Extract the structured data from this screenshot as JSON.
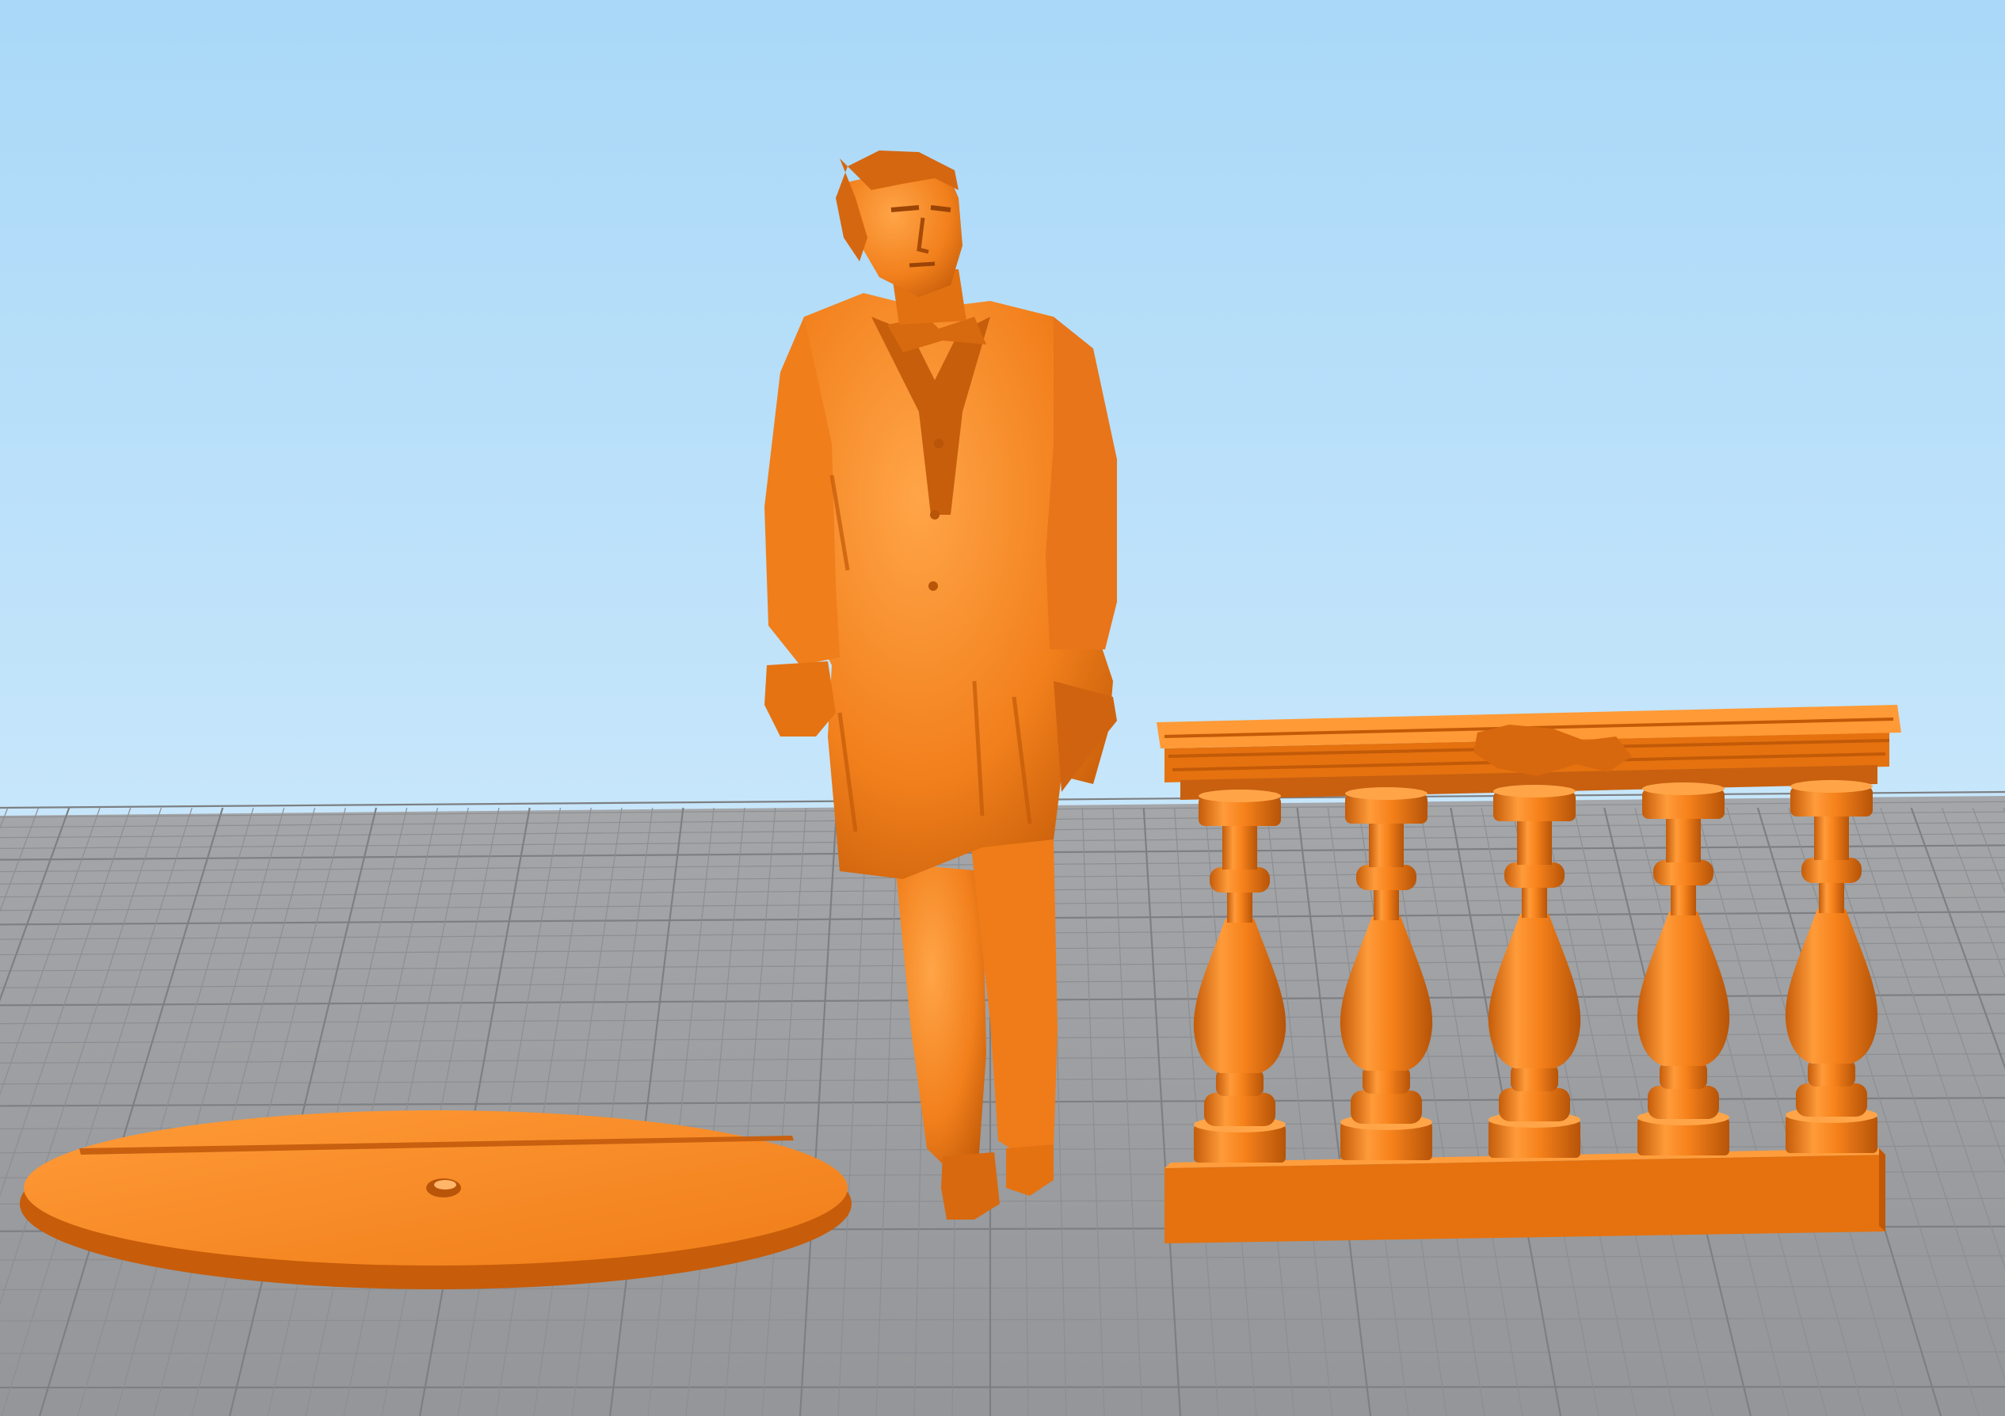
{
  "viewport": {
    "name": "3d-print-preview-viewport",
    "colors": {
      "sky_top": "#a9d8f8",
      "sky_bottom": "#c7e6fb",
      "bed": "#9d9fa2",
      "bed_grid_minor": "#8c8e91",
      "bed_grid_major": "#7d7f82",
      "model_base": "#f7821b",
      "model_light": "#ffa84a",
      "model_shadow": "#c85c0a",
      "model_dark": "#9a4406"
    }
  },
  "models": [
    {
      "id": "figure",
      "label": "",
      "shape": "standing-man-in-frock-coat"
    },
    {
      "id": "base",
      "label": "",
      "shape": "oval-base-with-slot"
    },
    {
      "id": "balustrade",
      "label": "",
      "shape": "balustrade-five-balusters"
    }
  ]
}
